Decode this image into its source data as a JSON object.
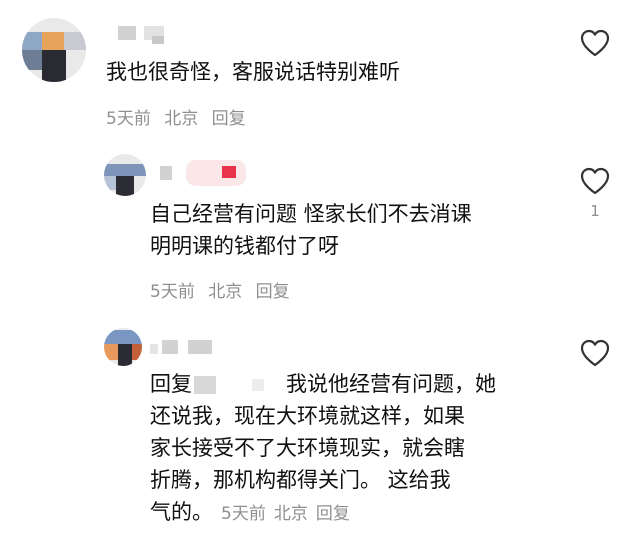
{
  "comments": [
    {
      "text": "我也很奇怪，客服说话特别难听",
      "time": "5天前",
      "location": "北京",
      "reply_label": "回复",
      "like_count": ""
    },
    {
      "text_line1": "自己经营有问题 怪家长们不去消课",
      "text_line2": "明明课的钱都付了呀",
      "time": "5天前",
      "location": "北京",
      "reply_label": "回复",
      "like_count": "1"
    },
    {
      "reply_prefix": "回复",
      "line1": "我说他经营有问题，她",
      "line2": "还说我，现在大环境就这样，如果",
      "line3": "家长接受不了大环境现实，就会瞎",
      "line4": "折腾，那机构都得关门。  这给我",
      "line5": "气的。",
      "time": "5天前",
      "location": "北京",
      "reply_label": "回复",
      "like_count": ""
    }
  ],
  "icons": {
    "like": "heart-outline-icon"
  },
  "colors": {
    "meta": "#8f8f8f",
    "text": "#111111",
    "accent_red": "#e8334a"
  }
}
